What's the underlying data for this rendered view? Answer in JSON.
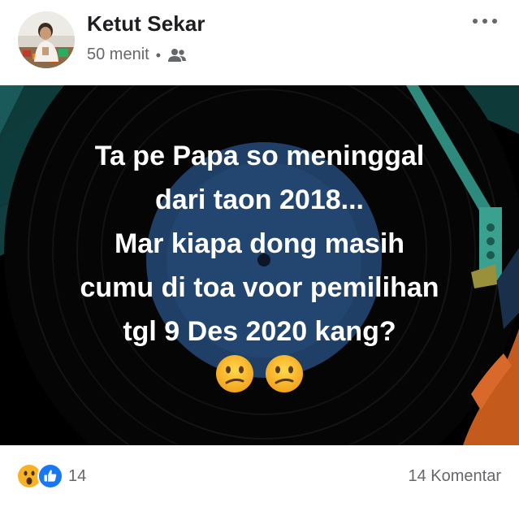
{
  "post": {
    "author_name": "Ketut Sekar",
    "time_ago": "50 menit",
    "separator": "•",
    "audience_icon": "friends-icon",
    "more_icon": "more-horizontal-icon"
  },
  "image": {
    "text_lines": [
      "Ta pe Papa so meninggal",
      "dari taon 2018...",
      "Mar kiapa dong masih",
      "cumu di toa voor pemilihan",
      "tgl 9 Des 2020 kang?"
    ],
    "emoji": [
      "confused-face-emoji",
      "confused-face-emoji"
    ]
  },
  "footer": {
    "reactions": [
      "wow-reaction-icon",
      "like-reaction-icon"
    ],
    "reaction_count": "14",
    "comment_count": "14 Komentar"
  },
  "colors": {
    "name_text": "#1c1e21",
    "meta_text": "#65676b",
    "image_bg": "#000000",
    "like_blue": "#1877f2",
    "wow_yellow": "#f7b125"
  }
}
